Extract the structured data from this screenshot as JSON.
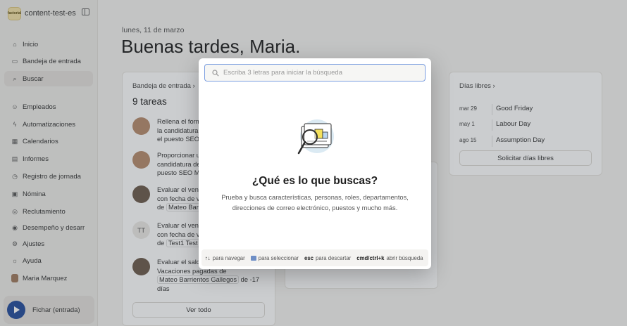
{
  "sidebar": {
    "workspace_logo": "factorial",
    "workspace_name": "content-test-es",
    "items": [
      {
        "label": "Inicio",
        "icon": "home-icon"
      },
      {
        "label": "Bandeja de entrada",
        "icon": "inbox-icon"
      },
      {
        "label": "Buscar",
        "icon": "search-icon"
      },
      {
        "label": "Empleados",
        "icon": "people-icon"
      },
      {
        "label": "Automatizaciones",
        "icon": "lightning-icon"
      },
      {
        "label": "Calendarios",
        "icon": "calendar-icon"
      },
      {
        "label": "Informes",
        "icon": "chart-icon"
      },
      {
        "label": "Registro de jornada",
        "icon": "clock-icon"
      },
      {
        "label": "Nómina",
        "icon": "payroll-icon"
      },
      {
        "label": "Reclutamiento",
        "icon": "globe-icon"
      },
      {
        "label": "Desempeño y desarr",
        "icon": "target-icon"
      },
      {
        "label": "Ajustes",
        "icon": "gear-icon"
      },
      {
        "label": "Ayuda",
        "icon": "help-icon"
      },
      {
        "label": "Maria Marquez",
        "icon": "avatar"
      }
    ],
    "clock_in_label": "Fichar (entrada)"
  },
  "main": {
    "date": "lunes, 11 de marzo",
    "greeting": "Buenas tardes, Maria.",
    "inbox": {
      "header": "Bandeja de entrada",
      "count": "9 tareas",
      "tasks": [
        {
          "lines": [
            "Rellena el form",
            "la candidatura",
            "el puesto SEO"
          ]
        },
        {
          "lines": [
            "Proporcionar u",
            "candidatura de",
            "puesto SEO Ma"
          ]
        },
        {
          "line1": "Evaluar el venc",
          "line2": "con fecha de v",
          "prefix": "de",
          "tag": "Mateo Barri"
        },
        {
          "avatar_initials": "TT",
          "line1": "Evaluar el venc",
          "line2": "con fecha de v",
          "prefix": "de",
          "tag": "Test1 Test"
        },
        {
          "line1": "Evaluar el sald",
          "line2": "Vacaciones pagadas de",
          "tag": "Mateo Barrientos Gallegos",
          "suffix": "de -17",
          "line4": "días"
        }
      ],
      "view_all": "Ver todo"
    },
    "days_off": {
      "header": "Días libres",
      "items": [
        {
          "date": "mar 29",
          "name": "Good Friday"
        },
        {
          "date": "may 1",
          "name": "Labour Day"
        },
        {
          "date": "ago 15",
          "name": "Assumption Day"
        }
      ],
      "request_button": "Solicitar días libres"
    }
  },
  "search_modal": {
    "placeholder": "Escriba 3 letras para iniciar la búsqueda",
    "title": "¿Qué es lo que buscas?",
    "description": "Prueba y busca características, personas, roles, departamentos, direcciones de correo electrónico, puestos y mucho más.",
    "footer": {
      "navigate": "para navegar",
      "select": "para seleccionar",
      "esc_key": "esc",
      "esc_label": "para descartar",
      "open_key": "cmd/ctrl+k",
      "open_label": "abrir búsqueda"
    },
    "colors": {
      "accent": "#7b9ee0",
      "brand_blue": "#244c9c"
    }
  }
}
